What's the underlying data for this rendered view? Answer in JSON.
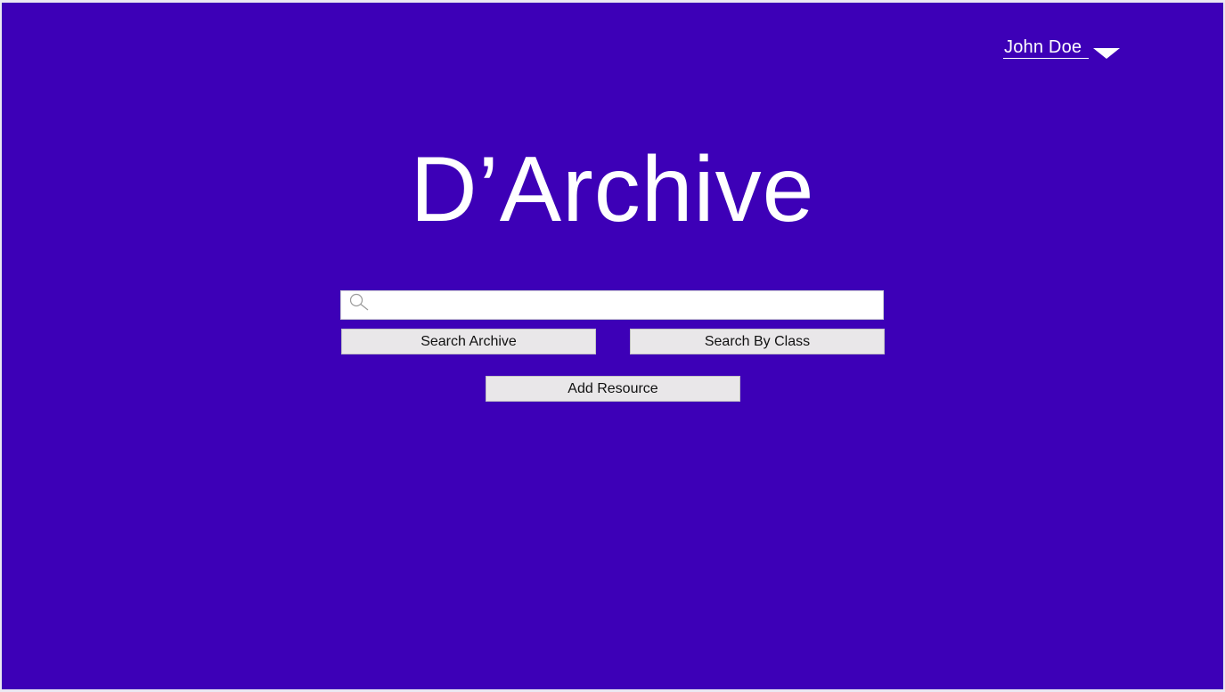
{
  "app": {
    "title": "D’Archive"
  },
  "user_menu": {
    "name": "John Doe",
    "caret_icon": "caret-down-icon"
  },
  "search": {
    "icon": "search-icon",
    "value": "",
    "placeholder": ""
  },
  "actions": {
    "search_archive_label": "Search Archive",
    "search_by_class_label": "Search By Class",
    "add_resource_label": "Add Resource"
  },
  "colors": {
    "background": "#3d00b7",
    "text": "#ffffff",
    "button_bg": "#e9e7e9",
    "button_text": "#111111"
  }
}
